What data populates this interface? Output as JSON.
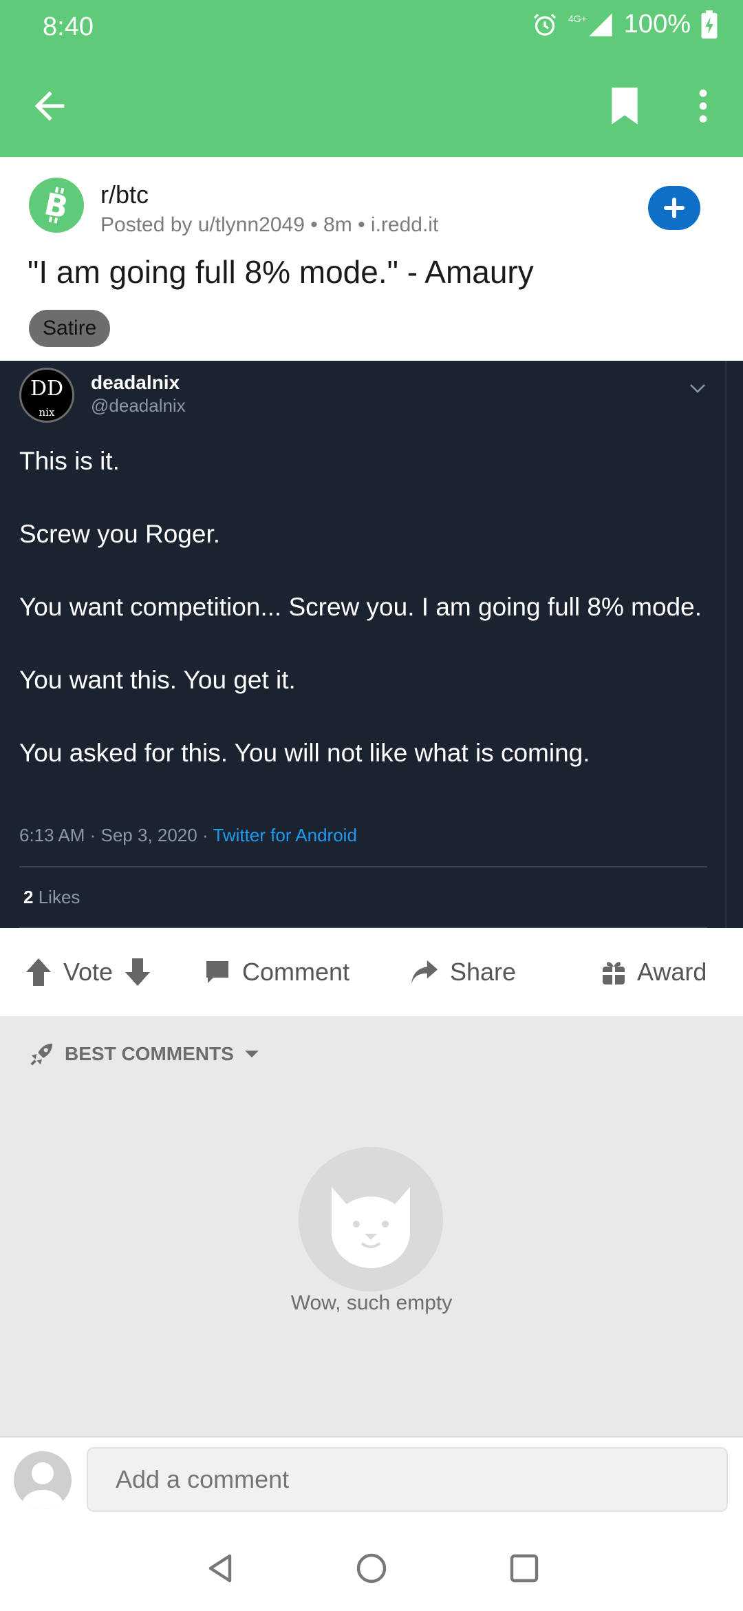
{
  "status_bar": {
    "time": "8:40",
    "network": "4G+",
    "battery": "100%"
  },
  "app_bar": {
    "icons": [
      "arrow-back-icon",
      "bookmark-icon",
      "more-vert-icon"
    ]
  },
  "post": {
    "subreddit": "r/btc",
    "meta": "Posted by u/tlynn2049 • 8m • i.redd.it",
    "title": "\"I am going full 8% mode.\" - Amaury",
    "flair": "Satire"
  },
  "tweet": {
    "display_name": "deadalnix",
    "handle": "@deadalnix",
    "avatar_text": "DD",
    "avatar_subtext": "nix",
    "paragraphs": [
      "This is it.",
      "Screw you Roger.",
      "You want competition... Screw you. I am going full 8% mode.",
      "You want this. You get it.",
      "You asked for this. You will not like what is coming."
    ],
    "timestamp": "6:13 AM · Sep 3, 2020 · ",
    "source": "Twitter for Android",
    "likes_count": "2",
    "likes_label": "Likes"
  },
  "actions": {
    "vote": "Vote",
    "comment": "Comment",
    "share": "Share",
    "award": "Award"
  },
  "comments": {
    "sort_label": "BEST COMMENTS",
    "empty_text": "Wow, such empty"
  },
  "comment_input": {
    "placeholder": "Add a comment"
  },
  "colors": {
    "accent": "#5fcb78",
    "join": "#0f6fc6",
    "tweet_bg": "#1b2230",
    "link": "#1d9bf0"
  }
}
